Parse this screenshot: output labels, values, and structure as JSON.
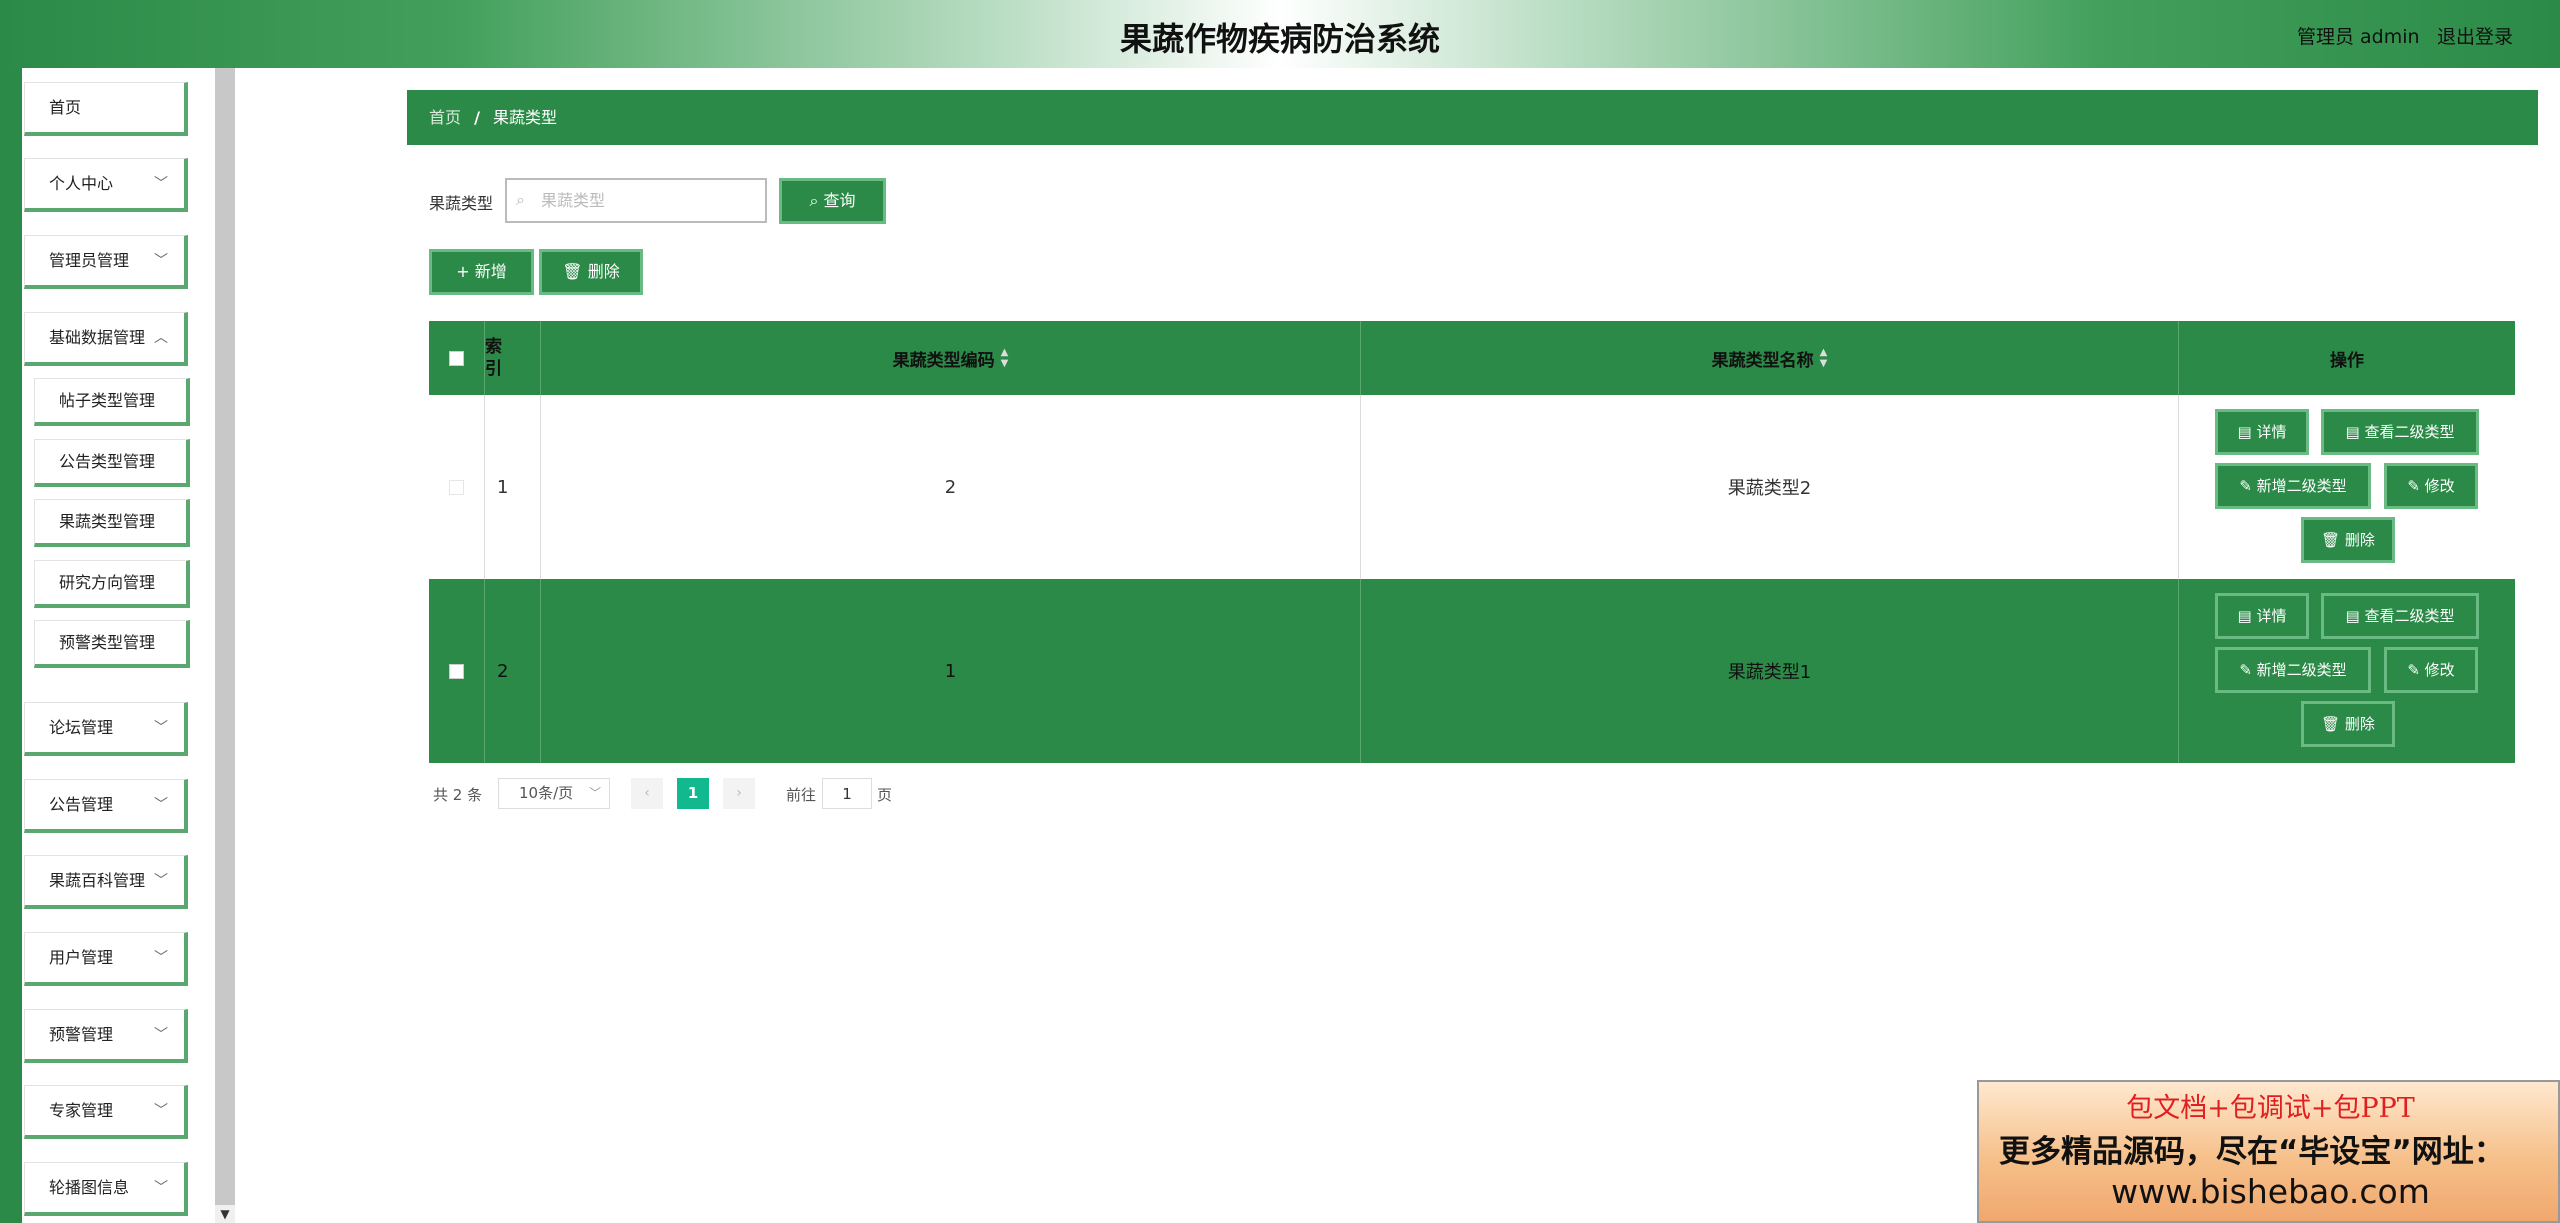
{
  "header": {
    "title": "果蔬作物疾病防治系统",
    "admin_label": "管理员 admin",
    "logout_label": "退出登录"
  },
  "sidebar": {
    "items": [
      {
        "label": "首页"
      },
      {
        "label": "个人中心"
      },
      {
        "label": "管理员管理"
      },
      {
        "label": "基础数据管理"
      },
      {
        "label": "帖子类型管理"
      },
      {
        "label": "公告类型管理"
      },
      {
        "label": "果蔬类型管理"
      },
      {
        "label": "研究方向管理"
      },
      {
        "label": "预警类型管理"
      },
      {
        "label": "论坛管理"
      },
      {
        "label": "公告管理"
      },
      {
        "label": "果蔬百科管理"
      },
      {
        "label": "用户管理"
      },
      {
        "label": "预警管理"
      },
      {
        "label": "专家管理"
      },
      {
        "label": "轮播图信息"
      }
    ]
  },
  "breadcrumb": {
    "home": "首页",
    "separator": "/",
    "current": "果蔬类型"
  },
  "search": {
    "label": "果蔬类型",
    "placeholder": "果蔬类型",
    "query_button": "查询"
  },
  "actions": {
    "add_button": "新增",
    "delete_button": "删除"
  },
  "table": {
    "headers": {
      "index": "索引",
      "code": "果蔬类型编码",
      "name": "果蔬类型名称",
      "ops": "操作"
    },
    "rows": [
      {
        "index": "1",
        "code": "2",
        "name": "果蔬类型2"
      },
      {
        "index": "2",
        "code": "1",
        "name": "果蔬类型1"
      }
    ],
    "row_actions": {
      "detail": "详情",
      "view_level2": "查看二级类型",
      "add_level2": "新增二级类型",
      "edit": "修改",
      "delete": "删除"
    }
  },
  "pagination": {
    "total": "共 2 条",
    "page_size": "10条/页",
    "current_page": "1",
    "goto_label": "前往",
    "goto_value": "1",
    "goto_suffix": "页"
  },
  "promo": {
    "line1": "包文档+包调试+包PPT",
    "line2": "更多精品源码，尽在“毕设宝”网址：",
    "line3": "www.bishebao.com"
  },
  "colors": {
    "primary": "#2b8a47",
    "accent_border": "#6aba83",
    "page_active": "#13b98e"
  }
}
